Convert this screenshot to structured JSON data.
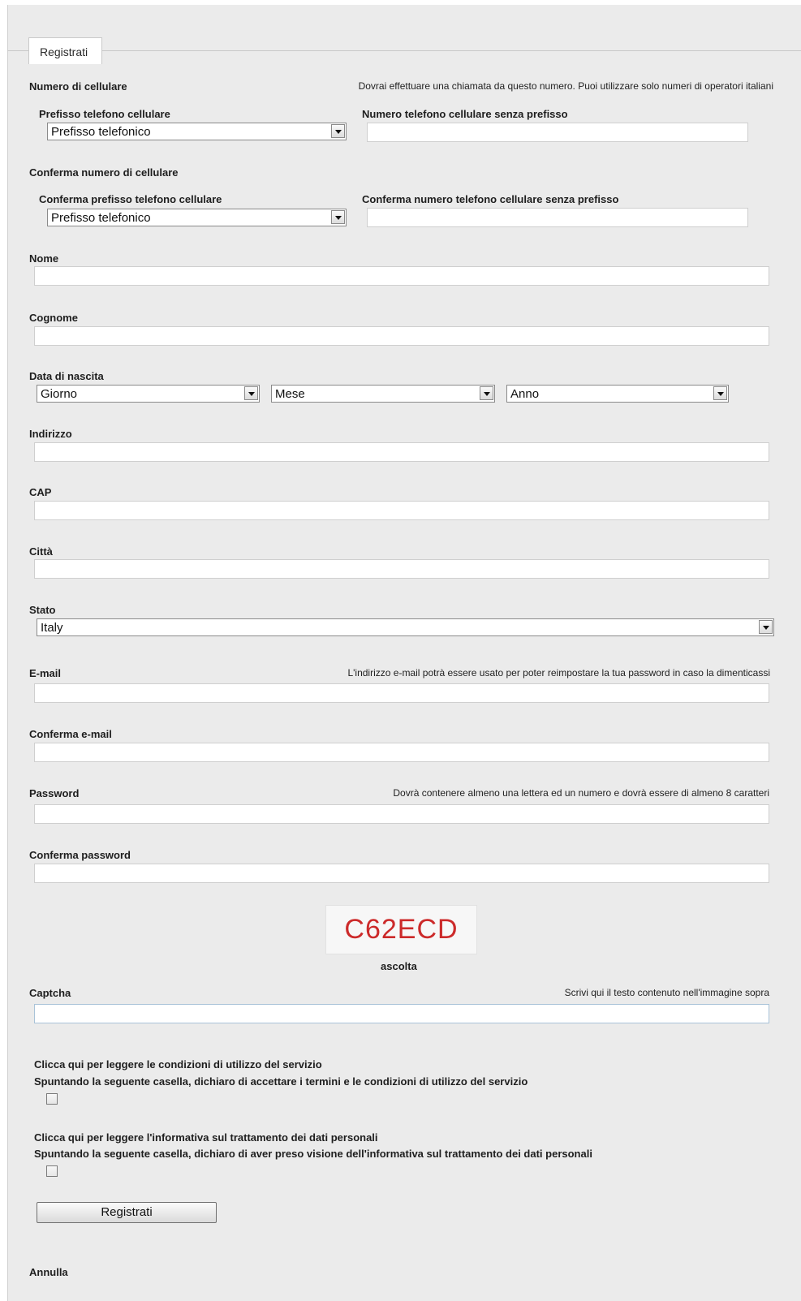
{
  "form": {
    "legend": "Registrati",
    "mobile": {
      "label": "Numero di cellulare",
      "hint": "Dovrai effettuare una chiamata da questo numero. Puoi utilizzare solo numeri di operatori italiani",
      "prefix_label": "Prefisso telefono cellulare",
      "prefix_value": "Prefisso telefonico",
      "number_label": "Numero telefono cellulare senza prefisso",
      "number_value": ""
    },
    "mobile_confirm": {
      "label": "Conferma numero di cellulare",
      "prefix_label": "Conferma prefisso telefono cellulare",
      "prefix_value": "Prefisso telefonico",
      "number_label": "Conferma numero telefono cellulare senza prefisso",
      "number_value": ""
    },
    "first_name": {
      "label": "Nome",
      "value": ""
    },
    "last_name": {
      "label": "Cognome",
      "value": ""
    },
    "birth_date": {
      "label": "Data di nascita",
      "day": "Giorno",
      "month": "Mese",
      "year": "Anno"
    },
    "address": {
      "label": "Indirizzo",
      "value": ""
    },
    "zip": {
      "label": "CAP",
      "value": ""
    },
    "city": {
      "label": "Città",
      "value": ""
    },
    "country": {
      "label": "Stato",
      "value": "Italy"
    },
    "email": {
      "label": "E-mail",
      "hint": "L'indirizzo e-mail potrà essere usato per poter reimpostare la tua password in caso la dimenticassi",
      "value": ""
    },
    "email_confirm": {
      "label": "Conferma e-mail",
      "value": ""
    },
    "password": {
      "label": "Password",
      "hint": "Dovrà contenere almeno una lettera ed un numero e dovrà essere di almeno 8 caratteri",
      "value": ""
    },
    "password_confirm": {
      "label": "Conferma password",
      "value": ""
    },
    "captcha": {
      "image_text": "C62ECD",
      "listen": "ascolta",
      "label": "Captcha",
      "hint": "Scrivi qui il testo contenuto nell'immagine sopra",
      "value": ""
    },
    "terms": {
      "link": "Clicca qui per leggere le condizioni di utilizzo del servizio",
      "text": "Spuntando la seguente casella, dichiaro di accettare i termini e le condizioni di utilizzo del servizio",
      "checked": false
    },
    "privacy": {
      "link": "Clicca qui per leggere l'informativa sul trattamento dei dati personali",
      "text": "Spuntando la seguente casella, dichiaro di aver preso visione dell'informativa sul trattamento dei dati personali",
      "checked": false
    },
    "submit_label": "Registrati",
    "cancel_label": "Annulla"
  },
  "colors": {
    "panel_bg": "#ebebeb",
    "captcha_text": "#cc2a2a"
  }
}
